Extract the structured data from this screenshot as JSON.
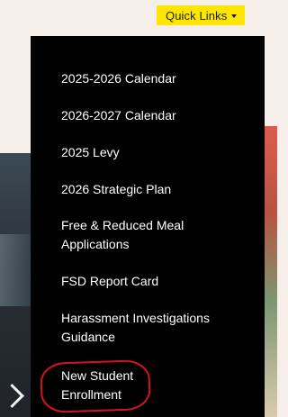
{
  "header": {
    "quick_links_label": "Quick Links"
  },
  "menu": {
    "items": [
      "2025-2026 Calendar",
      "2026-2027 Calendar",
      "2025 Levy",
      "2026 Strategic Plan",
      "Free & Reduced Meal Applications",
      "FSD Report Card",
      "Harassment Investigations Guidance",
      "New Student Enrollment"
    ]
  },
  "colors": {
    "accent": "#ffe600",
    "menu_background": "#000000",
    "highlight_annotation": "#d4141c"
  }
}
